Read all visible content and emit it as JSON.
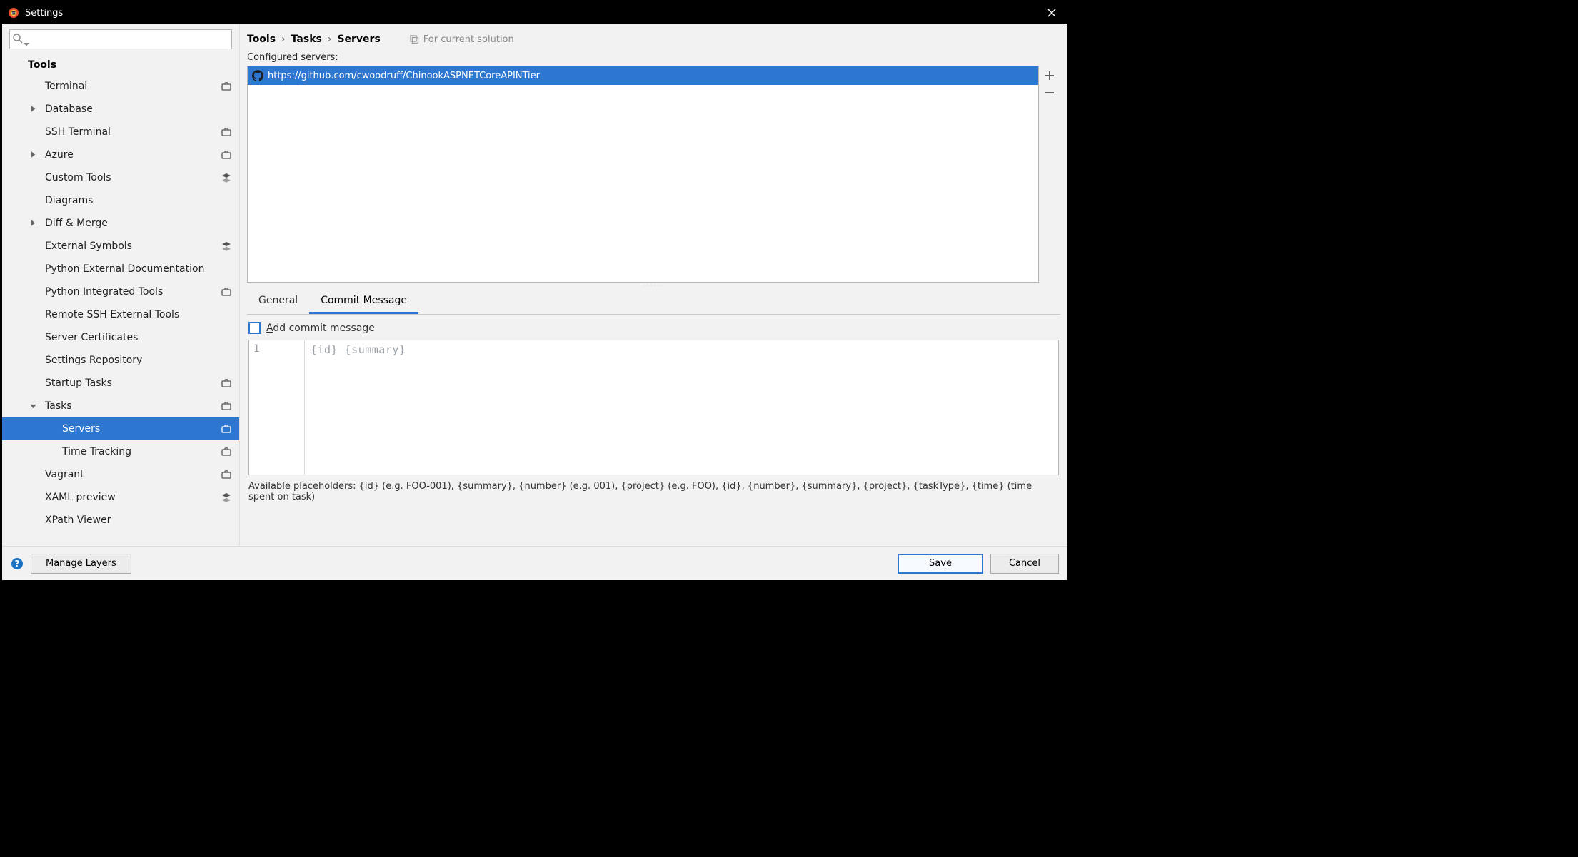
{
  "window": {
    "title": "Settings"
  },
  "search": {
    "placeholder": ""
  },
  "sidebar": {
    "header": "Tools",
    "items": [
      {
        "label": "Terminal",
        "icon": "briefcase",
        "arrow": ""
      },
      {
        "label": "Database",
        "icon": "",
        "arrow": "right"
      },
      {
        "label": "SSH Terminal",
        "icon": "briefcase",
        "arrow": ""
      },
      {
        "label": "Azure",
        "icon": "briefcase",
        "arrow": "right"
      },
      {
        "label": "Custom Tools",
        "icon": "layers",
        "arrow": ""
      },
      {
        "label": "Diagrams",
        "icon": "",
        "arrow": ""
      },
      {
        "label": "Diff & Merge",
        "icon": "",
        "arrow": "right"
      },
      {
        "label": "External Symbols",
        "icon": "layers",
        "arrow": ""
      },
      {
        "label": "Python External Documentation",
        "icon": "",
        "arrow": ""
      },
      {
        "label": "Python Integrated Tools",
        "icon": "briefcase",
        "arrow": ""
      },
      {
        "label": "Remote SSH External Tools",
        "icon": "",
        "arrow": ""
      },
      {
        "label": "Server Certificates",
        "icon": "",
        "arrow": ""
      },
      {
        "label": "Settings Repository",
        "icon": "",
        "arrow": ""
      },
      {
        "label": "Startup Tasks",
        "icon": "briefcase",
        "arrow": ""
      },
      {
        "label": "Tasks",
        "icon": "briefcase",
        "arrow": "down"
      },
      {
        "label": "Servers",
        "icon": "briefcase",
        "arrow": "",
        "child": true,
        "selected": true
      },
      {
        "label": "Time Tracking",
        "icon": "briefcase",
        "arrow": "",
        "child": true
      },
      {
        "label": "Vagrant",
        "icon": "briefcase",
        "arrow": ""
      },
      {
        "label": "XAML preview",
        "icon": "layers",
        "arrow": ""
      },
      {
        "label": "XPath Viewer",
        "icon": "",
        "arrow": ""
      }
    ]
  },
  "breadcrumb": {
    "c0": "Tools",
    "c1": "Tasks",
    "c2": "Servers",
    "sep": "›"
  },
  "scope": {
    "label": "For current solution"
  },
  "servers": {
    "label": "Configured servers:",
    "items": [
      {
        "url": "https://github.com/cwoodruff/ChinookASPNETCoreAPINTier"
      }
    ]
  },
  "tabs": {
    "t0": "General",
    "t1": "Commit Message"
  },
  "commit": {
    "checkbox_label": "Add commit message",
    "gutter_line": "1",
    "placeholder": "{id} {summary}",
    "hint": "Available placeholders: {id} (e.g. FOO-001), {summary}, {number} (e.g. 001), {project} (e.g. FOO), {id}, {number}, {summary}, {project}, {taskType}, {time} (time spent on task)"
  },
  "footer": {
    "manage_layers": "Manage Layers",
    "save": "Save",
    "cancel": "Cancel"
  }
}
